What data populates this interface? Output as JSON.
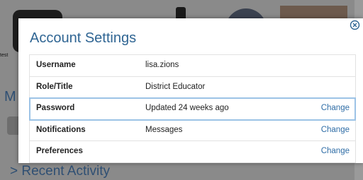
{
  "background": {
    "left_snippet": "test",
    "left_letter": "M",
    "recent_heading": "> Recent Activity"
  },
  "modal": {
    "title": "Account Settings",
    "close_icon": "close-circle-icon",
    "rows": [
      {
        "label": "Username",
        "value": "lisa.zions",
        "action": ""
      },
      {
        "label": "Role/Title",
        "value": "District Educator",
        "action": ""
      },
      {
        "label": "Password",
        "value": "Updated 24 weeks ago",
        "action": "Change"
      },
      {
        "label": "Notifications",
        "value": "Messages",
        "action": "Change"
      },
      {
        "label": "Preferences",
        "value": "",
        "action": "Change"
      }
    ]
  },
  "colors": {
    "title": "#2f6593",
    "link": "#2f6da6",
    "highlight_border": "#9cc3e6",
    "overlay": "#8a8a8a"
  }
}
